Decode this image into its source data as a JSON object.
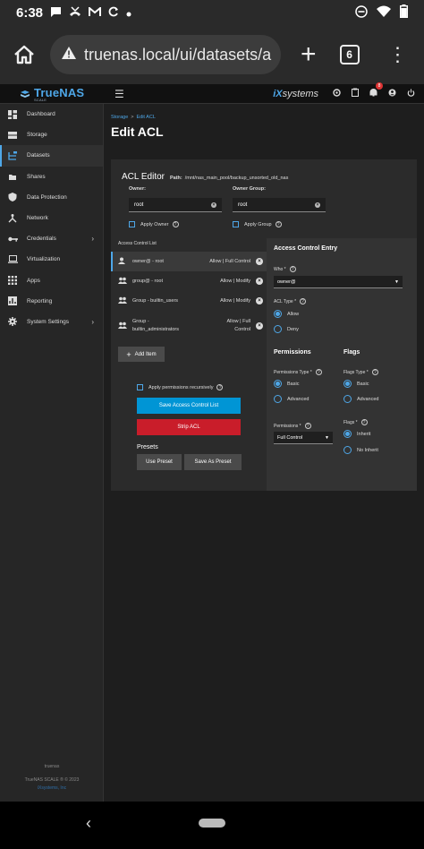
{
  "status": {
    "time": "6:38",
    "left_icons": [
      "chat-bubble-icon",
      "phone-missed-icon",
      "gmail-icon",
      "sync-icon",
      "dot-icon"
    ],
    "right_icons": [
      "do-not-disturb-icon",
      "wifi-icon",
      "battery-icon"
    ]
  },
  "browser": {
    "url": "truenas.local/ui/datasets/a",
    "tab_count": "6"
  },
  "topbar": {
    "brand": "TrueNAS",
    "brand_sub": "SCALE",
    "vendor_prefix": "iX",
    "vendor": "systems",
    "alert_count": "8"
  },
  "sidebar": {
    "items": [
      {
        "label": "Dashboard",
        "icon": "dashboard-icon"
      },
      {
        "label": "Storage",
        "icon": "storage-icon"
      },
      {
        "label": "Datasets",
        "icon": "datasets-icon"
      },
      {
        "label": "Shares",
        "icon": "shares-icon"
      },
      {
        "label": "Data Protection",
        "icon": "shield-icon"
      },
      {
        "label": "Network",
        "icon": "network-icon"
      },
      {
        "label": "Credentials",
        "icon": "key-icon"
      },
      {
        "label": "Virtualization",
        "icon": "laptop-icon"
      },
      {
        "label": "Apps",
        "icon": "apps-icon"
      },
      {
        "label": "Reporting",
        "icon": "chart-icon"
      },
      {
        "label": "System Settings",
        "icon": "gear-icon"
      }
    ],
    "footer": [
      "truenas",
      "TrueNAS SCALE ® © 2023",
      "iXsystems, Inc"
    ]
  },
  "page": {
    "breadcrumb": [
      "Storage",
      "Edit ACL"
    ],
    "title": "Edit ACL"
  },
  "acl_editor": {
    "title": "ACL Editor",
    "path_label": "Path:",
    "path": "/mnt/nas_main_pool/backup_unsorted_old_nas",
    "owner_label": "Owner:",
    "owner_value": "root",
    "owner_group_label": "Owner Group:",
    "owner_group_value": "root",
    "apply_owner": "Apply Owner",
    "apply_group": "Apply Group",
    "list_title": "Access Control List",
    "entries": [
      {
        "who": "owner@ - root",
        "perm": "Allow | Full Control"
      },
      {
        "who": "group@ - root",
        "perm": "Allow | Modify"
      },
      {
        "who": "Group - builtin_users",
        "perm": "Allow | Modify"
      },
      {
        "who_line1": "Group -",
        "who_line2": "builtin_administrators",
        "perm_line1": "Allow | Full",
        "perm_line2": "Control"
      }
    ],
    "add_item": "Add Item",
    "apply_recursive": "Apply permissions recursively",
    "save_button": "Save Access Control List",
    "strip_button": "Strip ACL",
    "presets_label": "Presets",
    "use_preset": "Use Preset",
    "save_preset": "Save As Preset"
  },
  "entry_panel": {
    "title": "Access Control Entry",
    "who_label": "Who *",
    "who_value": "owner@",
    "acl_type_label": "ACL Type *",
    "acl_type_options": [
      "Allow",
      "Deny"
    ],
    "acl_type_selected": "Allow",
    "permissions_title": "Permissions",
    "flags_title": "Flags",
    "perm_type_label": "Permissions Type *",
    "perm_type_options": [
      "Basic",
      "Advanced"
    ],
    "flags_type_label": "Flags Type *",
    "flags_type_options": [
      "Basic",
      "Advanced"
    ],
    "permissions_label": "Permissions *",
    "permissions_value": "Full Control",
    "flags_label": "Flags *",
    "flags_options": [
      "Inherit",
      "No Inherit"
    ]
  },
  "colors": {
    "accent": "#4ea7e8",
    "primary_button": "#0095d5",
    "danger_button": "#c91d2a"
  }
}
